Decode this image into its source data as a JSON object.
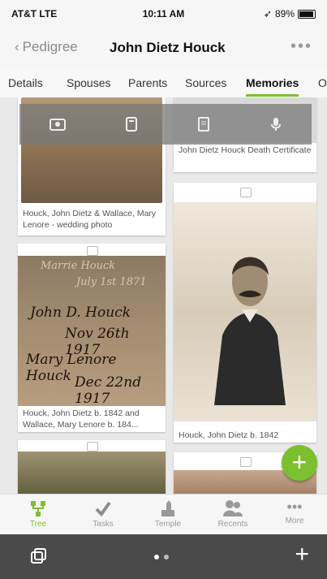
{
  "status": {
    "carrier": "AT&T  LTE",
    "time": "10:11 AM",
    "battery": "89%"
  },
  "nav": {
    "back": "Pedigree",
    "title": "John Dietz Houck",
    "more": "•••"
  },
  "tabs": [
    "Details",
    "Spouses",
    "Parents",
    "Sources",
    "Memories",
    "O"
  ],
  "cards": [
    {
      "caption": "Houck, John Dietz & Wallace, Mary Lenore -  wedding photo"
    },
    {
      "caption": "John Dietz Houck Death Certificate"
    },
    {
      "caption": "Houck, John Dietz b. 1842 and Wallace, Mary Lenore b. 184..."
    },
    {
      "caption": "Houck, John Dietz b. 1842"
    }
  ],
  "handwriting": {
    "line1": "John D. Houck",
    "line2": "Nov 26th 1917",
    "line3": "Mary Lenore Houck",
    "line4": "Dec 22nd 1917",
    "top": "Marrie Houck",
    "top2": "July 1st 1871"
  },
  "tabbar": [
    "Tree",
    "Tasks",
    "Temple",
    "Recents",
    "More"
  ],
  "bottom": {
    "plus": "+"
  }
}
